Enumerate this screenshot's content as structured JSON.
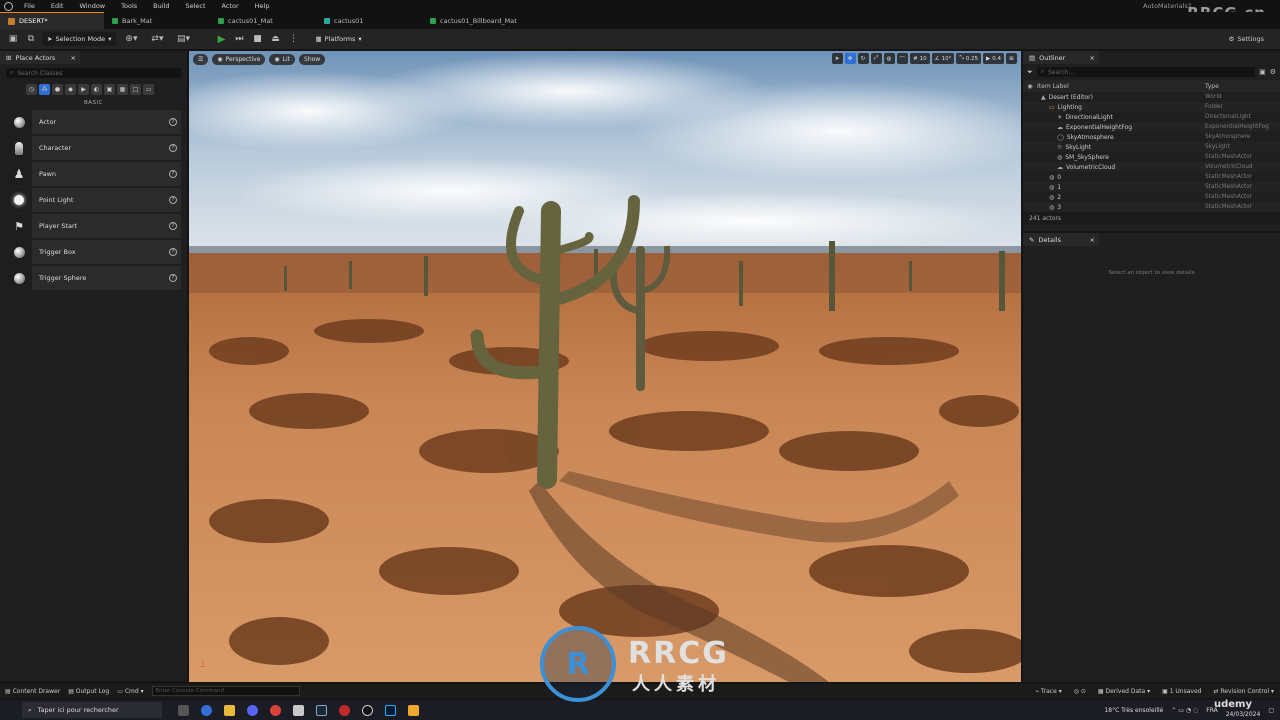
{
  "menu": {
    "items": [
      "File",
      "Edit",
      "Window",
      "Tools",
      "Build",
      "Select",
      "Actor",
      "Help"
    ],
    "project": "AutoMaterials1"
  },
  "watermark": {
    "top": "RRCG.cn",
    "center_main": "RRCG",
    "center_sub": "人人素材",
    "udemy": "udemy"
  },
  "tabs": [
    {
      "label": "DESERT*",
      "type": "level"
    },
    {
      "label": "Bark_Mat",
      "type": "material"
    },
    {
      "label": "cactus01_Mat",
      "type": "material"
    },
    {
      "label": "cactus01",
      "type": "mesh"
    },
    {
      "label": "cactus01_Billboard_Mat",
      "type": "material"
    }
  ],
  "toolbar": {
    "mode": "Selection Mode",
    "platforms": "Platforms",
    "settings": "Settings"
  },
  "place_actors": {
    "title": "Place Actors",
    "search_placeholder": "Search Classes",
    "section": "BASIC",
    "items": [
      {
        "label": "Actor",
        "icon": "sphere-icon"
      },
      {
        "label": "Character",
        "icon": "character-icon"
      },
      {
        "label": "Pawn",
        "icon": "pawn-icon"
      },
      {
        "label": "Point Light",
        "icon": "bulb-icon"
      },
      {
        "label": "Player Start",
        "icon": "flag-icon"
      },
      {
        "label": "Trigger Box",
        "icon": "box-icon"
      },
      {
        "label": "Trigger Sphere",
        "icon": "sphere-icon"
      }
    ]
  },
  "viewport": {
    "perspective": "Perspective",
    "lit": "Lit",
    "show": "Show",
    "grid": "10",
    "angle": "10°",
    "scale": "0.25",
    "camera_speed": "0.4"
  },
  "outliner": {
    "title": "Outliner",
    "search_placeholder": "Search...",
    "col_label": "Item Label",
    "col_type": "Type",
    "rows": [
      {
        "label": "Desert (Editor)",
        "type": "World"
      },
      {
        "label": "Lighting",
        "type": "Folder"
      },
      {
        "label": "DirectionalLight",
        "type": "DirectionalLight"
      },
      {
        "label": "ExponentialHeightFog",
        "type": "ExponentialHeightFog"
      },
      {
        "label": "SkyAtmosphere",
        "type": "SkyAtmosphere"
      },
      {
        "label": "SkyLight",
        "type": "SkyLight"
      },
      {
        "label": "SM_SkySphere",
        "type": "StaticMeshActor"
      },
      {
        "label": "VolumetricCloud",
        "type": "VolumetricCloud"
      },
      {
        "label": "0",
        "type": "StaticMeshActor"
      },
      {
        "label": "1",
        "type": "StaticMeshActor"
      },
      {
        "label": "2",
        "type": "StaticMeshActor"
      },
      {
        "label": "3",
        "type": "StaticMeshActor"
      }
    ],
    "count": "241 actors"
  },
  "details": {
    "title": "Details",
    "empty": "Select an object to view details"
  },
  "statusbar": {
    "content_drawer": "Content Drawer",
    "output_log": "Output Log",
    "cmd": "Cmd",
    "console_placeholder": "Enter Console Command",
    "trace": "Trace",
    "derived": "Derived Data",
    "unsaved": "1 Unsaved",
    "revision": "Revision Control"
  },
  "taskbar": {
    "search": "Taper ici pour rechercher",
    "weather": "18°C  Très ensoleillé",
    "lang": "FRA",
    "date": "24/03/2024"
  }
}
